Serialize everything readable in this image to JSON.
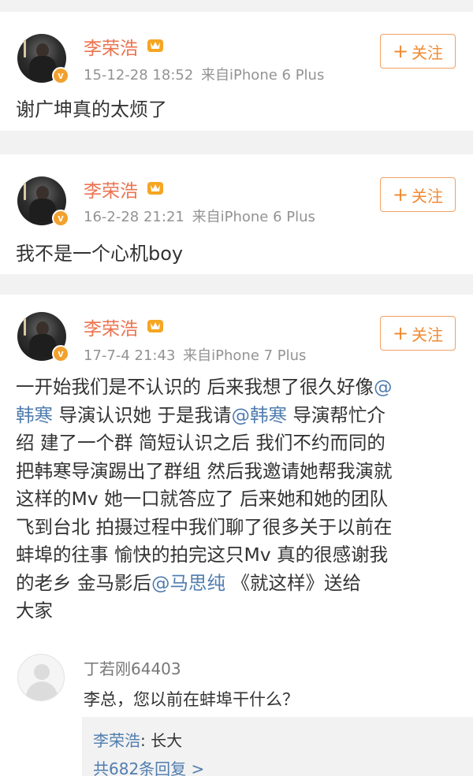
{
  "posts": [
    {
      "username": "李荣浩",
      "date": "15-12-28 18:52",
      "source": "来自iPhone 6 Plus",
      "follow_label": "关注",
      "text": "谢广坤真的太烦了"
    },
    {
      "username": "李荣浩",
      "date": "16-2-28 21:21",
      "source": "来自iPhone 6 Plus",
      "follow_label": "关注",
      "text": "我不是一个心机boy"
    },
    {
      "username": "李荣浩",
      "date": "17-7-4 21:43",
      "source": "来自iPhone 7 Plus",
      "follow_label": "关注",
      "lines": [
        [
          "一开始我们是不认识的 后来我想了很久好像",
          "@"
        ],
        [
          "韩寒",
          " 导演认识她 于是我请",
          "@韩寒",
          " 导演帮忙介"
        ],
        [
          "绍 建了一个群 简短认识之后 我们不约而同的"
        ],
        [
          "把韩寒导演踢出了群组 然后我邀请她帮我演就"
        ],
        [
          "这样的Mv 她一口就答应了 后来她和她的团队"
        ],
        [
          "飞到台北 拍摄过程中我们聊了很多关于以前在"
        ],
        [
          "蚌埠的往事 愉快的拍完这只Mv 真的很感谢我"
        ],
        [
          "的老乡 金马影后",
          "@马思纯",
          "  《就这样》送给"
        ],
        [
          "大家"
        ]
      ]
    }
  ],
  "comment": {
    "username": "丁若刚64403",
    "text": "李总，您以前在蚌埠干什么？",
    "reply_name": "李荣浩",
    "reply_text": ": 长大",
    "reply_count": "共682条回复 >"
  },
  "colors": {
    "username": "#eb7350",
    "mention": "#507daf",
    "follow_border": "#f0a063",
    "badge": "#f2a12e"
  }
}
